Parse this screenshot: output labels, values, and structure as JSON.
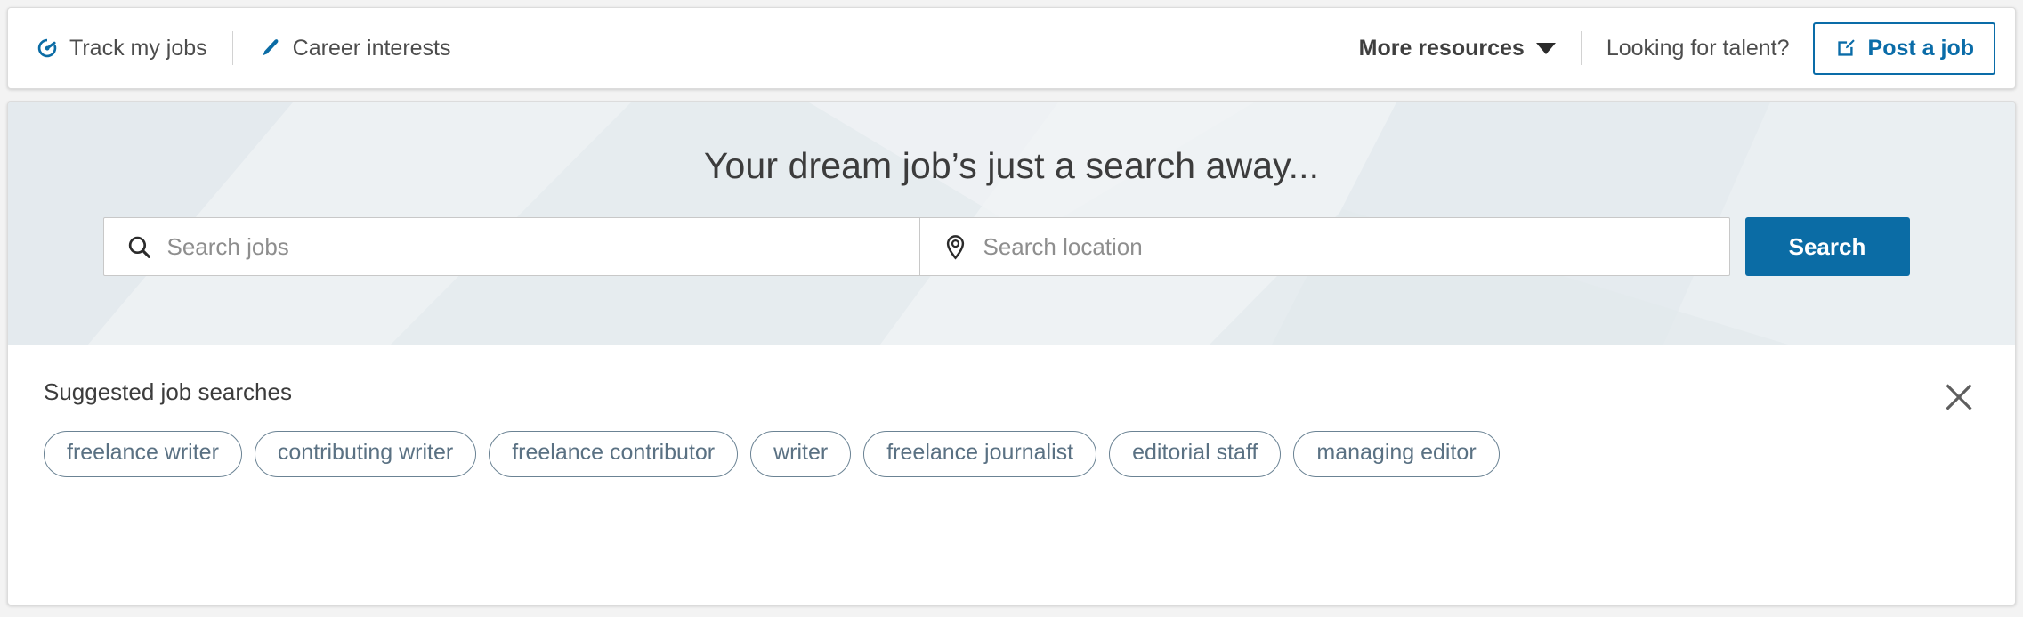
{
  "header": {
    "track_jobs": {
      "label": "Track my jobs",
      "icon": "gauge-icon"
    },
    "career_interests": {
      "label": "Career interests",
      "icon": "pencil-icon"
    },
    "more_resources": {
      "label": "More resources",
      "icon": "chevron-down-icon"
    },
    "looking_for_talent": "Looking for talent?",
    "post_job": {
      "label": "Post a job",
      "icon": "compose-icon"
    }
  },
  "hero": {
    "title": "Your dream job’s just a search away...",
    "job_field": {
      "placeholder": "Search jobs",
      "value": "",
      "icon": "search-icon"
    },
    "location_field": {
      "placeholder": "Search location",
      "value": "",
      "icon": "location-pin-icon"
    },
    "search_button": "Search"
  },
  "suggestions": {
    "title": "Suggested job searches",
    "close_icon": "close-icon",
    "chips": [
      "freelance writer",
      "contributing writer",
      "freelance contributor",
      "writer",
      "freelance journalist",
      "editorial staff",
      "managing editor"
    ]
  },
  "colors": {
    "brand_blue": "#0b6ca5",
    "link_blue": "#0a6ca8",
    "hero_bg": "#e9eef1",
    "chip_border": "#6b8394",
    "chip_text": "#5a7183",
    "text_gray": "#4d4d4d"
  }
}
